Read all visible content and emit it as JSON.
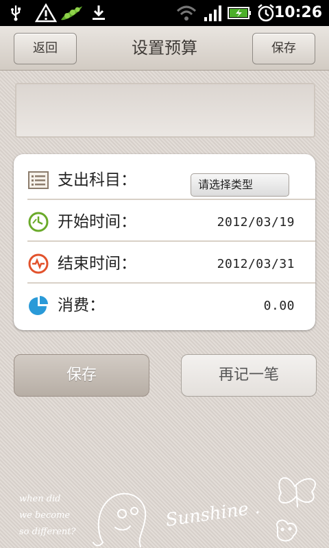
{
  "status_bar": {
    "time": "10:26",
    "icons": [
      "usb-icon",
      "warning-icon",
      "pea-pod-icon",
      "download-icon",
      "wifi-icon",
      "signal-icon",
      "battery-charging-icon",
      "alarm-icon"
    ]
  },
  "header": {
    "title": "设置预算",
    "back_label": "返回",
    "save_label": "保存"
  },
  "memo": {
    "value": ""
  },
  "form": {
    "category": {
      "label": "支出科目：",
      "value": "请选择类型",
      "icon": "list-icon"
    },
    "start": {
      "label": "开始时间：",
      "value": "2012/03/19",
      "icon": "clock-green-icon"
    },
    "end": {
      "label": "结束时间：",
      "value": "2012/03/31",
      "icon": "clock-red-icon"
    },
    "spend": {
      "label": "消费：",
      "value": "0.00",
      "icon": "pie-chart-icon"
    }
  },
  "actions": {
    "save_label": "保存",
    "again_label": "再记一笔"
  },
  "decor": {
    "left_text_1": "when did",
    "left_text_2": "we become",
    "left_text_3": "so different?",
    "center_text": "Sunshine ."
  },
  "colors": {
    "accent_green": "#6aaa2a",
    "accent_red": "#e2522c",
    "accent_blue": "#2a9ad8"
  }
}
